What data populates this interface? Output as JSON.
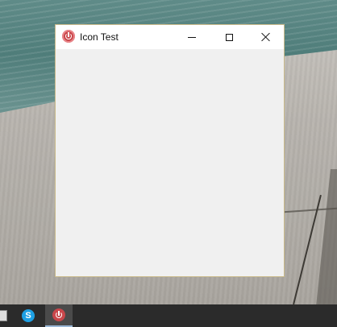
{
  "window": {
    "title": "Icon Test",
    "icon": "power-icon",
    "controls": [
      "minimize",
      "maximize",
      "close"
    ]
  },
  "taskbar": {
    "items": [
      {
        "name": "document-app",
        "icon": "document-icon",
        "active": false
      },
      {
        "name": "skype",
        "icon": "skype-icon",
        "glyph": "S",
        "active": false
      },
      {
        "name": "icon-test",
        "icon": "power-icon",
        "active": true
      }
    ]
  },
  "colors": {
    "app_icon": "#c9474b",
    "skype": "#1ea0e4",
    "taskbar": "#2b2b2b",
    "window_body": "#f0f0f0"
  }
}
